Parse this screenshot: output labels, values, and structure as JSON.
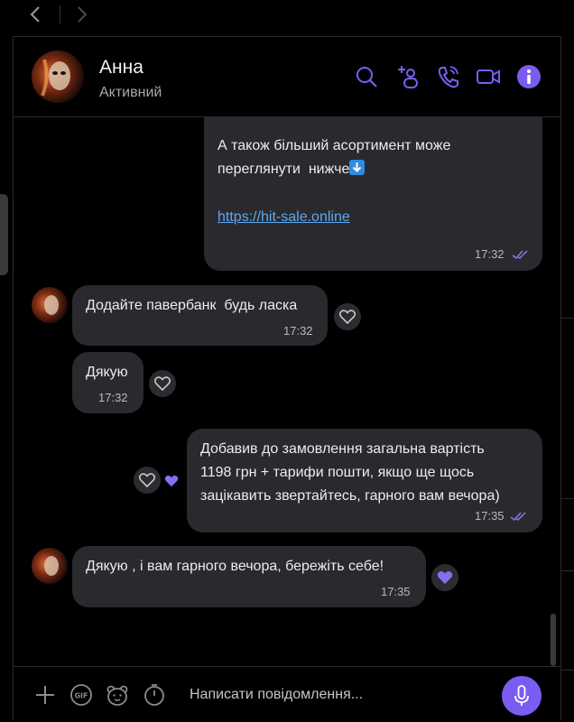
{
  "nav": {
    "back_icon": "chevron-left-icon",
    "forward_icon": "chevron-right-icon"
  },
  "header": {
    "name": "Анна",
    "status": "Активний",
    "icons": [
      "search-icon",
      "add-participant-icon",
      "audio-call-icon",
      "video-call-icon",
      "info-icon"
    ]
  },
  "messages": [
    {
      "direction": "out",
      "text_line1": "А також більший асортимент може",
      "text_line2": "переглянути  нижче",
      "emoji": "down-arrow-emoji",
      "link": "https://hit-sale.online",
      "time": "17:32",
      "read": true
    },
    {
      "direction": "in",
      "text": "Додайте павербанк  будь ласка",
      "time": "17:32"
    },
    {
      "direction": "in",
      "text": "Дякую",
      "time": "17:32"
    },
    {
      "direction": "out",
      "text_lines": [
        "Добавив до замовлення загальна вартість",
        "1198 грн + тарифи пошти, якщо ще щось",
        "зацікавить звертайтесь, гарного вам вечора)"
      ],
      "time": "17:35",
      "read": true
    },
    {
      "direction": "in",
      "text": "Дякую , і вам гарного вечора, бережіть себе!",
      "time": "17:35"
    }
  ],
  "composer": {
    "placeholder": "Написати повідомлення...",
    "icons": [
      "plus-icon",
      "gif-icon",
      "sticker-icon",
      "timer-icon",
      "microphone-icon"
    ]
  },
  "colors": {
    "accent": "#7b5cf0",
    "bubble": "#2a2a2e",
    "link": "#5fa8f0",
    "background": "#000000"
  }
}
